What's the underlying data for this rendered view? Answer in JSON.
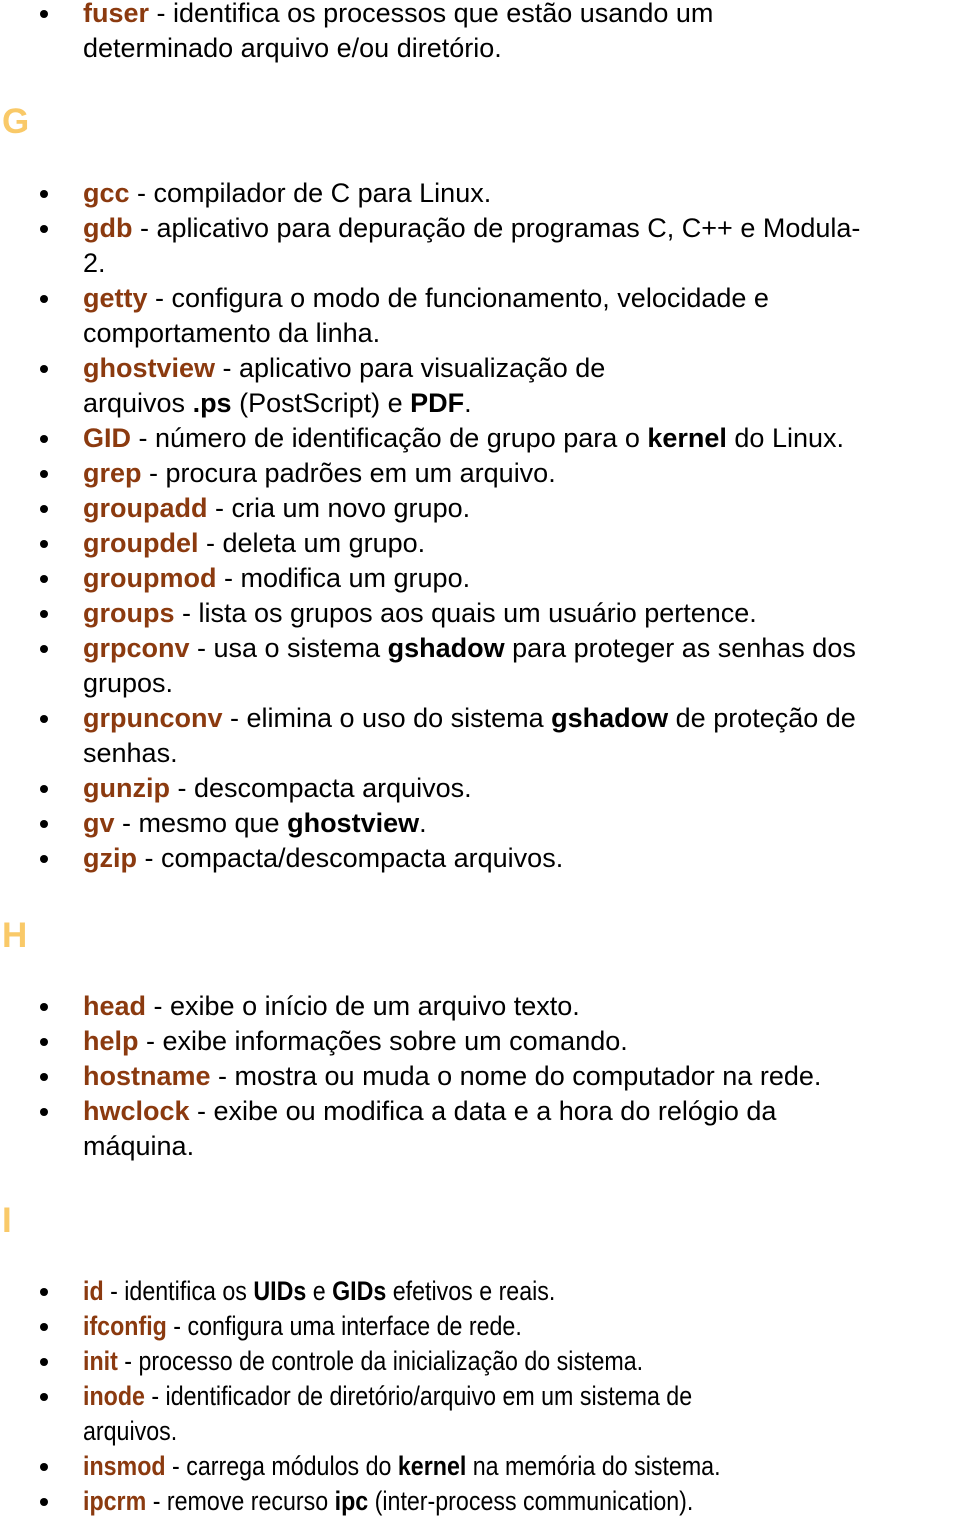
{
  "colors": {
    "term": "#8B3A0F",
    "heading": "#F9C968",
    "text": "#000000"
  },
  "intro": [
    {
      "term": "fuser",
      "parts": [
        " - identifica os processos que estão usando um",
        "determinado arquivo e/ou diretório."
      ]
    }
  ],
  "sections": [
    {
      "letter": "G",
      "items": [
        {
          "term": "gcc",
          "text": " - compilador de C para Linux."
        },
        {
          "term": "gdb",
          "text": " - aplicativo para depuração de programas C, C++ e Modula-",
          "line2": "2."
        },
        {
          "term": "getty",
          "text": " - configura o modo de funcionamento, velocidade e",
          "line2": "comportamento da linha."
        },
        {
          "term": "ghostview",
          "text": " - aplicativo para visualização de",
          "line2_a": "arquivos ",
          "line2_b1": ".ps",
          "line2_c": " (PostScript) e ",
          "line2_b2": "PDF",
          "line2_d": "."
        },
        {
          "term": "GID",
          "text_a": " - número de identificação de grupo para o ",
          "bold": "kernel",
          "text_b": " do Linux."
        },
        {
          "term": "grep",
          "text": " - procura padrões em um arquivo."
        },
        {
          "term": "groupadd",
          "text": " - cria um novo grupo."
        },
        {
          "term": "groupdel",
          "text": " - deleta um grupo."
        },
        {
          "term": "groupmod",
          "text": " - modifica um grupo."
        },
        {
          "term": "groups",
          "text": " - lista os grupos aos quais um usuário pertence."
        },
        {
          "term": "grpconv",
          "text_a": " - usa o sistema ",
          "bold": "gshadow",
          "text_b": " para proteger as senhas dos",
          "line2": "grupos."
        },
        {
          "term": "grpunconv",
          "text_a": " - elimina o uso do sistema ",
          "bold": "gshadow",
          "text_b": " de proteção de",
          "line2": "senhas."
        },
        {
          "term": "gunzip",
          "text": " - descompacta arquivos."
        },
        {
          "term": "gv",
          "text_a": " - mesmo que ",
          "bold": "ghostview",
          "text_b": "."
        },
        {
          "term": "gzip",
          "text": " - compacta/descompacta arquivos."
        }
      ]
    },
    {
      "letter": "H",
      "items": [
        {
          "term": "head",
          "text": " - exibe o início de um arquivo texto."
        },
        {
          "term": "help",
          "text": " - exibe informações sobre um comando."
        },
        {
          "term": "hostname",
          "text": " - mostra ou muda o nome do computador na rede."
        },
        {
          "term": "hwclock",
          "text": " - exibe ou modifica a data e a hora do relógio da",
          "line2": "máquina."
        }
      ]
    },
    {
      "letter": "I",
      "items": [
        {
          "term": "id",
          "text_a": " - identifica os ",
          "bold": "UIDs",
          "text_b": " e ",
          "bold2": "GIDs",
          "text_c": " efetivos e reais."
        },
        {
          "term": "ifconfig",
          "text": " - configura uma interface de rede."
        },
        {
          "term": "init",
          "text": " - processo de controle da inicialização do sistema."
        },
        {
          "term": "inode",
          "text": " - identificador de diretório/arquivo em um sistema de",
          "line2": "arquivos."
        },
        {
          "term": "insmod",
          "text_a": " - carrega módulos do ",
          "bold": "kernel",
          "text_b": " na memória do sistema."
        },
        {
          "term": "ipcrm",
          "text_a": " - remove recurso ",
          "bold": "ipc",
          "text_b": " (inter-process communication)."
        }
      ]
    }
  ]
}
